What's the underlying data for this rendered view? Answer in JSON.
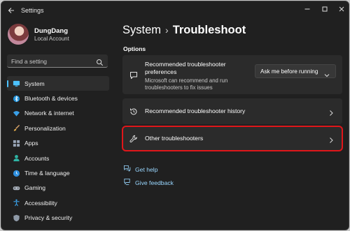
{
  "window": {
    "title": "Settings"
  },
  "user": {
    "name": "DungDang",
    "account": "Local Account"
  },
  "search": {
    "placeholder": "Find a setting"
  },
  "nav": {
    "items": [
      {
        "label": "System",
        "icon": "monitor-icon",
        "active": true
      },
      {
        "label": "Bluetooth & devices",
        "icon": "bluetooth-icon"
      },
      {
        "label": "Network & internet",
        "icon": "wifi-icon"
      },
      {
        "label": "Personalization",
        "icon": "brush-icon"
      },
      {
        "label": "Apps",
        "icon": "apps-icon"
      },
      {
        "label": "Accounts",
        "icon": "person-icon"
      },
      {
        "label": "Time & language",
        "icon": "globe-clock-icon"
      },
      {
        "label": "Gaming",
        "icon": "gamepad-icon"
      },
      {
        "label": "Accessibility",
        "icon": "accessibility-icon"
      },
      {
        "label": "Privacy & security",
        "icon": "shield-icon"
      }
    ]
  },
  "header": {
    "parent": "System",
    "separator": "›",
    "current": "Troubleshoot"
  },
  "options": {
    "heading": "Options",
    "preferences": {
      "title": "Recommended troubleshooter preferences",
      "description": "Microsoft can recommend and run troubleshooters to fix issues",
      "dropdown_value": "Ask me before running"
    },
    "history": {
      "title": "Recommended troubleshooter history"
    },
    "other": {
      "title": "Other troubleshooters"
    }
  },
  "links": {
    "help": "Get help",
    "feedback": "Give feedback"
  },
  "colors": {
    "accent": "#4cc2ff",
    "link": "#99d7ff",
    "highlight": "#e0161a",
    "background": "#202020",
    "card": "#2b2b2b"
  }
}
